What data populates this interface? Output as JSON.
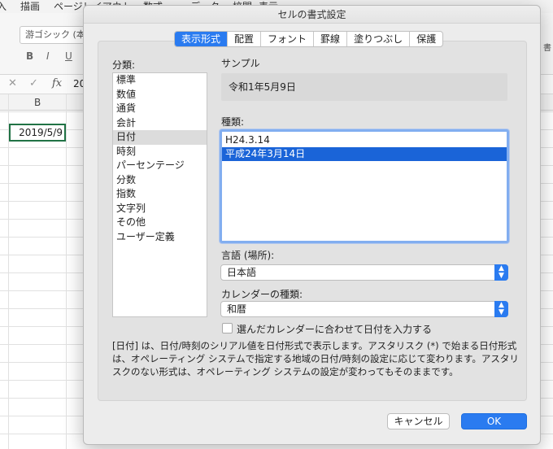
{
  "excel": {
    "ribbon_tabs": [
      "入",
      "描画",
      "ページレイアウト",
      "数式",
      "データ",
      "校閲",
      "表示"
    ],
    "font_name": "游ゴシック (本文",
    "format_buttons": [
      "B",
      "I",
      "U"
    ],
    "ribbon_right_text": "書",
    "formula_value": "20",
    "column_header": "B",
    "cell_b2": "2019/5/9"
  },
  "dialog": {
    "title": "セルの書式設定",
    "tabs": [
      {
        "label": "表示形式",
        "active": true
      },
      {
        "label": "配置"
      },
      {
        "label": "フォント"
      },
      {
        "label": "罫線"
      },
      {
        "label": "塗りつぶし"
      },
      {
        "label": "保護"
      }
    ],
    "category_label": "分類:",
    "categories": [
      "標準",
      "数値",
      "通貨",
      "会計",
      "日付",
      "時刻",
      "パーセンテージ",
      "分数",
      "指数",
      "文字列",
      "その他",
      "ユーザー定義"
    ],
    "selected_category": "日付",
    "sample_label": "サンプル",
    "sample_value": "令和1年5月9日",
    "type_label": "種類:",
    "types": [
      "H24.3.14",
      "平成24年3月14日"
    ],
    "selected_type": "平成24年3月14日",
    "locale_label": "言語 (場所):",
    "locale_value": "日本語",
    "calendar_label": "カレンダーの種類:",
    "calendar_value": "和暦",
    "checkbox_label": "選んだカレンダーに合わせて日付を入力する",
    "description": "[日付] は、日付/時刻のシリアル値を日付形式で表示します。アスタリスク (*) で始まる日付形式は、オペレーティング システムで指定する地域の日付/時刻の設定に応じて変わります。アスタリスクのない形式は、オペレーティング システムの設定が変わってもそのままです。",
    "cancel_label": "キャンセル",
    "ok_label": "OK"
  },
  "colors": {
    "accent": "#2a7bf0",
    "list_selection": "#1a64d8",
    "excel_green": "#217346"
  }
}
